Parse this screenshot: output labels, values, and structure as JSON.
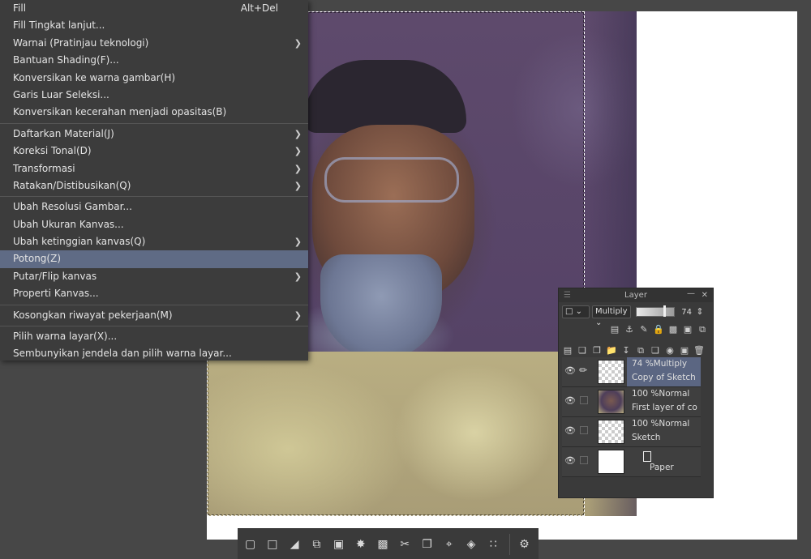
{
  "menu": {
    "items": [
      {
        "label": "Fill",
        "shortcut": "Alt+Del",
        "submenu": false
      },
      {
        "label": "Fill Tingkat lanjut...",
        "shortcut": "",
        "submenu": false
      },
      {
        "label": "Warnai (Pratinjau teknologi)",
        "shortcut": "",
        "submenu": true
      },
      {
        "label": "Bantuan Shading(F)...",
        "shortcut": "",
        "submenu": false
      },
      {
        "label": "Konversikan ke warna gambar(H)",
        "shortcut": "",
        "submenu": false
      },
      {
        "label": "Garis Luar Seleksi...",
        "shortcut": "",
        "submenu": false
      },
      {
        "label": "Konversikan kecerahan menjadi opasitas(B)",
        "shortcut": "",
        "submenu": false
      },
      {
        "label": "Daftarkan Material(J)",
        "shortcut": "",
        "submenu": true
      },
      {
        "label": "Koreksi Tonal(D)",
        "shortcut": "",
        "submenu": true
      },
      {
        "label": "Transformasi",
        "shortcut": "",
        "submenu": true
      },
      {
        "label": "Ratakan/Distibusikan(Q)",
        "shortcut": "",
        "submenu": true
      },
      {
        "label": "Ubah Resolusi Gambar...",
        "shortcut": "",
        "submenu": false
      },
      {
        "label": "Ubah Ukuran Kanvas...",
        "shortcut": "",
        "submenu": false
      },
      {
        "label": "Ubah ketinggian kanvas(Q)",
        "shortcut": "",
        "submenu": true
      },
      {
        "label": "Potong(Z)",
        "shortcut": "",
        "submenu": false,
        "selected": true
      },
      {
        "label": "Putar/Flip kanvas",
        "shortcut": "",
        "submenu": true
      },
      {
        "label": "Properti Kanvas...",
        "shortcut": "",
        "submenu": false
      },
      {
        "label": "Kosongkan riwayat pekerjaan(M)",
        "shortcut": "",
        "submenu": true
      },
      {
        "label": "Pilih warna layar(X)...",
        "shortcut": "",
        "submenu": false
      },
      {
        "label": "Sembunyikan jendela dan pilih warna layar...",
        "shortcut": "",
        "submenu": false
      }
    ]
  },
  "layer_panel": {
    "title": "Layer",
    "blend_mode": "Multiply",
    "opacity": "74",
    "opacity_fraction": 0.74,
    "layers": [
      {
        "line1": "74 %Multiply",
        "line2": "Copy of Sketch",
        "active": true
      },
      {
        "line1": "100 %Normal",
        "line2": "First layer of co",
        "active": false
      },
      {
        "line1": "100 %Normal",
        "line2": "Sketch",
        "active": false
      },
      {
        "line1": "",
        "line2": "Paper",
        "active": false
      }
    ]
  },
  "icons": {
    "menu_arrow": "chevron-right-icon",
    "eye": "eye-icon",
    "pen": "pen-icon"
  },
  "colors": {
    "menu_bg": "#3c3c3c",
    "menu_selected": "#5f6b85",
    "layer_selected": "#5b6682",
    "workspace": "#474747"
  }
}
